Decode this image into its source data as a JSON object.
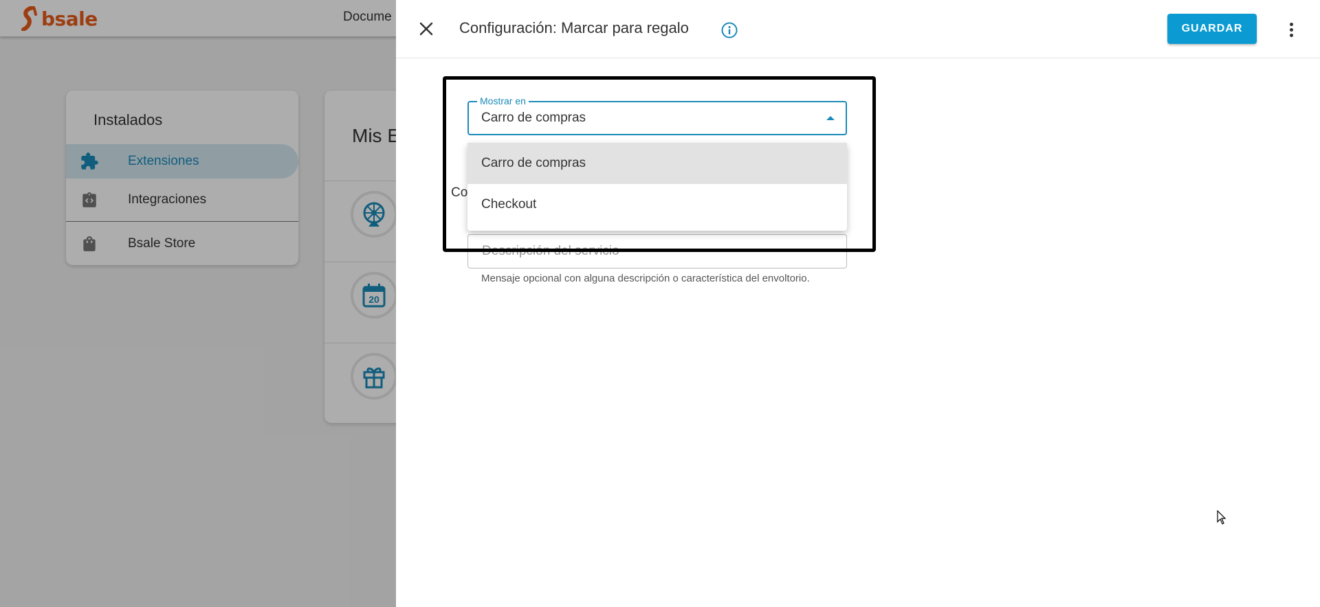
{
  "app": {
    "logo_text": "bsale",
    "nav_item": "Docume"
  },
  "sidebar": {
    "title": "Instalados",
    "items": [
      {
        "label": "Extensiones",
        "icon": "puzzle-icon",
        "active": true
      },
      {
        "label": "Integraciones",
        "icon": "code-bag-icon",
        "active": false
      },
      {
        "label": "Bsale Store",
        "icon": "shopping-bag-icon",
        "active": false
      }
    ]
  },
  "main_card": {
    "title": "Mis E",
    "extensions": [
      {
        "icon": "wheel-icon"
      },
      {
        "icon": "calendar-icon",
        "calendar_day": "20"
      },
      {
        "icon": "gift-icon"
      }
    ]
  },
  "drawer": {
    "title": "Configuración: Marcar para regalo",
    "save_label": "GUARDAR",
    "partial_label": "Co",
    "select": {
      "label": "Mostrar en",
      "value": "Carro de compras",
      "options": [
        "Carro de compras",
        "Checkout"
      ],
      "highlighted_option": "Carro de compras"
    },
    "description": {
      "placeholder": "Descripción del servicio",
      "value": "",
      "helper": "Mensaje opcional con alguna descripción o característica del envoltorio."
    }
  },
  "colors": {
    "accent": "#0b9bd2",
    "brand": "#e85c1b",
    "active_bg": "#d4e9f1"
  }
}
